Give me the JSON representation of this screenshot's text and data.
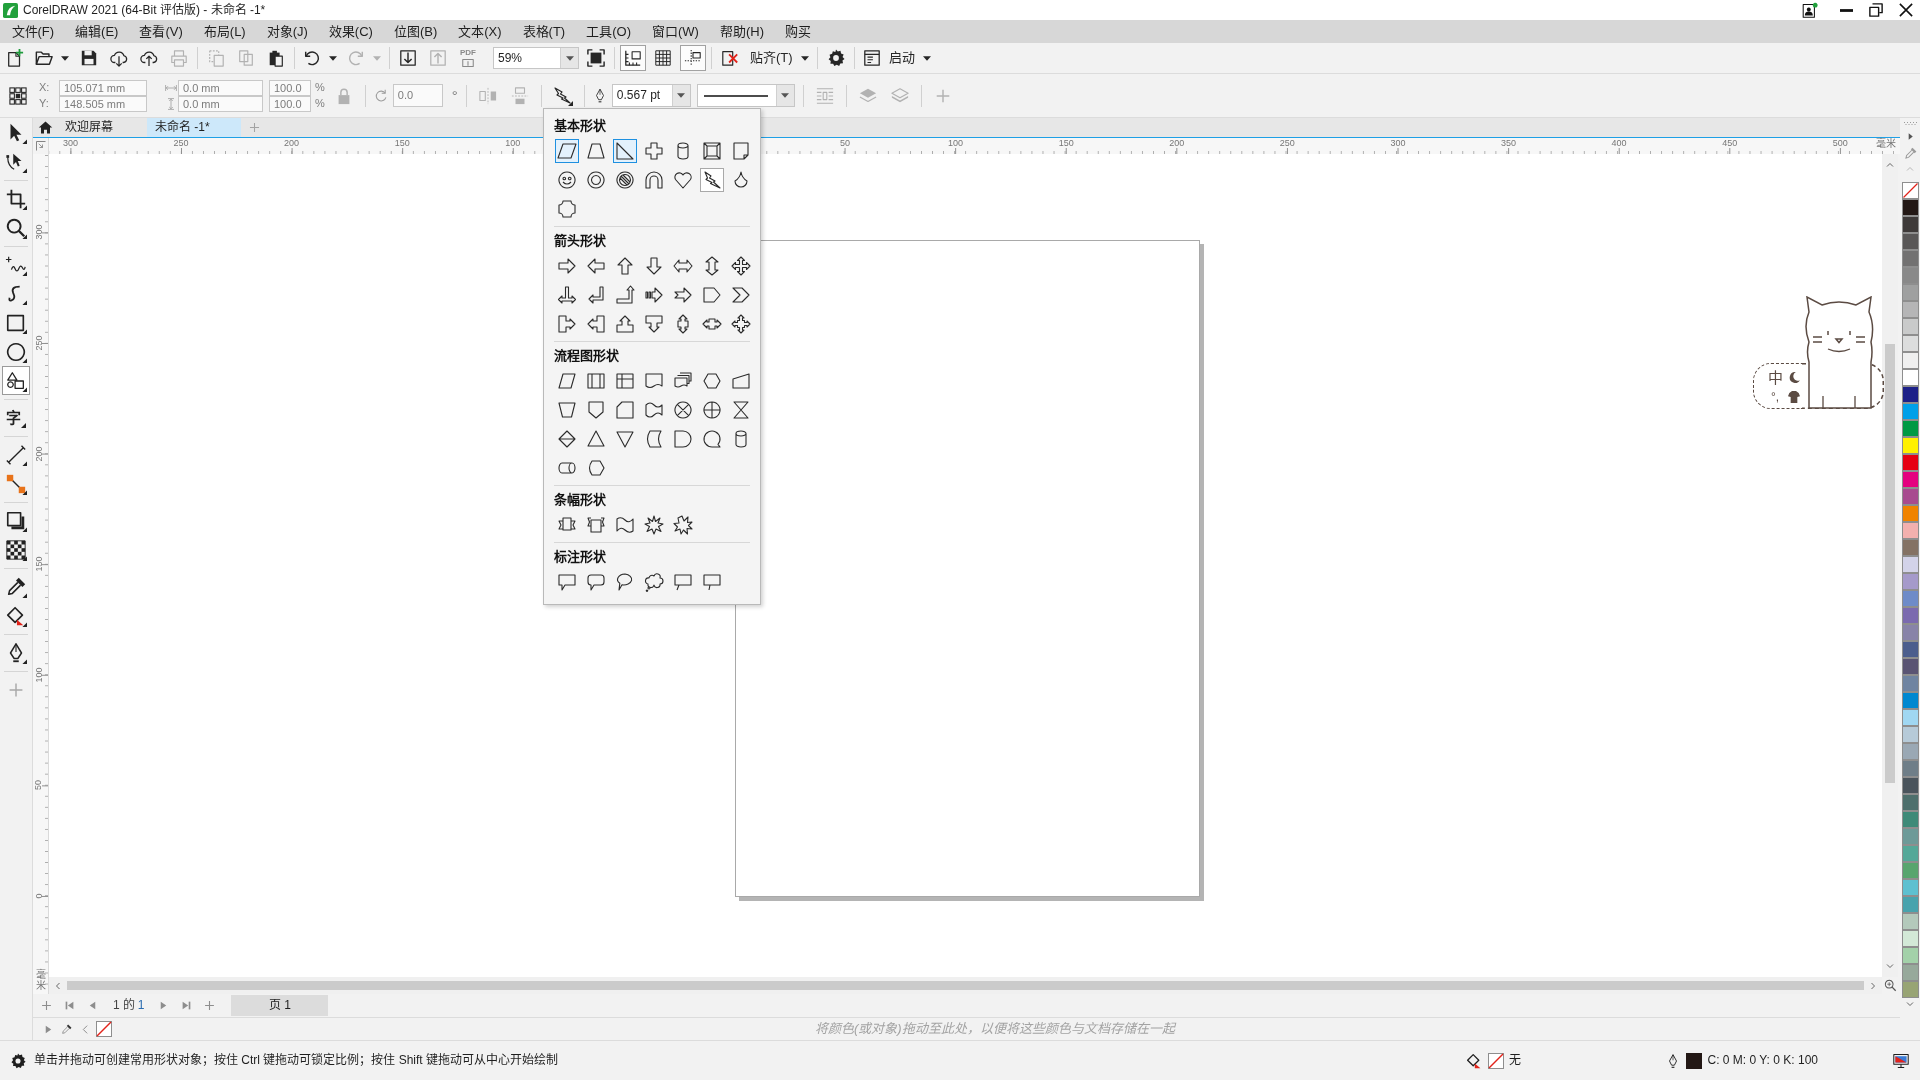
{
  "window": {
    "title": "CorelDRAW 2021 (64-Bit 评估版) - 未命名 -1*"
  },
  "menu_bar": [
    "文件(F)",
    "编辑(E)",
    "查看(V)",
    "布局(L)",
    "对象(J)",
    "效果(C)",
    "位图(B)",
    "文本(X)",
    "表格(T)",
    "工具(O)",
    "窗口(W)",
    "帮助(H)",
    "购买"
  ],
  "standard_toolbar": [
    [
      {
        "kind": "new",
        "disabled": false,
        "active": false,
        "dropdown": false
      },
      {
        "kind": "open",
        "disabled": false,
        "active": false,
        "dropdown": true
      },
      {
        "kind": "save",
        "disabled": false,
        "active": false,
        "dropdown": false
      },
      {
        "kind": "clouddown",
        "disabled": false,
        "active": false,
        "dropdown": false
      },
      {
        "kind": "cloudup",
        "disabled": false,
        "active": false,
        "dropdown": false
      },
      {
        "kind": "print",
        "disabled": true,
        "active": false,
        "dropdown": false
      }
    ],
    [
      {
        "kind": "cut",
        "disabled": true,
        "active": false,
        "dropdown": false
      },
      {
        "kind": "copy",
        "disabled": true,
        "active": false,
        "dropdown": false
      },
      {
        "kind": "paste",
        "disabled": false,
        "active": false,
        "dropdown": false
      }
    ],
    [
      {
        "kind": "undo",
        "disabled": false,
        "active": false,
        "dropdown": true
      },
      {
        "kind": "redo",
        "disabled": true,
        "active": false,
        "dropdown": true
      }
    ],
    [
      {
        "kind": "import",
        "disabled": false,
        "active": false,
        "dropdown": false
      },
      {
        "kind": "export",
        "disabled": true,
        "active": false,
        "dropdown": false
      },
      {
        "kind": "pdf",
        "label": "PDF",
        "disabled": true,
        "active": false,
        "dropdown": false
      },
      {
        "kind": "zoom",
        "value": "59%",
        "disabled": false,
        "active": false,
        "dropdown": true
      },
      {
        "kind": "fullscreen",
        "disabled": false,
        "active": false,
        "dropdown": false
      }
    ],
    [
      {
        "kind": "rulers",
        "disabled": false,
        "active": true,
        "dropdown": false
      },
      {
        "kind": "grid",
        "disabled": false,
        "active": false,
        "dropdown": false
      },
      {
        "kind": "guidelines",
        "disabled": false,
        "active": true,
        "dropdown": false
      }
    ],
    [
      {
        "kind": "snapoff",
        "disabled": false,
        "active": false,
        "dropdown": false
      },
      {
        "kind": "snap",
        "label": "贴齐(T)",
        "disabled": false,
        "active": false,
        "dropdown": true
      }
    ],
    [
      {
        "kind": "options",
        "disabled": false,
        "active": false,
        "dropdown": false
      }
    ],
    [
      {
        "kind": "launch",
        "label": "启动",
        "disabled": false,
        "active": false,
        "dropdown": true
      }
    ]
  ],
  "property_bar": [
    [
      {
        "kind": "origin",
        "disabled": false
      },
      {
        "kind": "position",
        "disabled": true,
        "rows": [
          {
            "label": "X:",
            "value": "105.071 mm"
          },
          {
            "label": "Y:",
            "value": "148.505 mm"
          }
        ]
      },
      {
        "kind": "size",
        "disabled": true,
        "rows": [
          {
            "value": "0.0 mm"
          },
          {
            "value": "0.0 mm"
          }
        ]
      },
      {
        "kind": "scale",
        "disabled": true,
        "rows": [
          {
            "value": "100.0",
            "unit": "%"
          },
          {
            "value": "100.0",
            "unit": "%"
          }
        ]
      },
      {
        "kind": "lock",
        "disabled": true
      }
    ],
    [
      {
        "kind": "rotation",
        "disabled": true,
        "value": "0.0",
        "unit": "°"
      }
    ],
    [
      {
        "kind": "mirrorh",
        "disabled": true
      },
      {
        "kind": "mirrorv",
        "disabled": true
      }
    ],
    [
      {
        "kind": "shapes",
        "disabled": false
      }
    ],
    [
      {
        "kind": "outline",
        "disabled": false,
        "value": "0.567 pt"
      },
      {
        "kind": "linestyle",
        "disabled": false
      }
    ],
    [
      {
        "kind": "wrap",
        "disabled": true
      }
    ],
    [
      {
        "kind": "front",
        "disabled": true
      },
      {
        "kind": "back",
        "disabled": true
      }
    ],
    [
      {
        "kind": "add",
        "disabled": true
      }
    ]
  ],
  "document_tabs": [
    {
      "label": "欢迎屏幕",
      "selected": false
    },
    {
      "label": "未命名 -1*",
      "selected": true
    }
  ],
  "toolbox": [
    [
      {
        "kind": "pick",
        "selected": false
      },
      {
        "kind": "shape",
        "selected": false
      }
    ],
    [
      {
        "kind": "crop",
        "selected": false
      },
      {
        "kind": "zoom",
        "selected": false
      }
    ],
    [
      {
        "kind": "freehand",
        "selected": false
      },
      {
        "kind": "artistic",
        "selected": false
      },
      {
        "kind": "rectangle",
        "selected": false
      },
      {
        "kind": "ellipse",
        "selected": false
      },
      {
        "kind": "shapes",
        "selected": true
      }
    ],
    [
      {
        "kind": "text",
        "label": "字",
        "selected": false
      }
    ],
    [
      {
        "kind": "dimension",
        "selected": false
      },
      {
        "kind": "connector",
        "selected": false
      }
    ],
    [
      {
        "kind": "shadow",
        "selected": false
      },
      {
        "kind": "transparency",
        "selected": false
      }
    ],
    [
      {
        "kind": "eyedropper",
        "selected": false
      },
      {
        "kind": "fill",
        "selected": false
      }
    ],
    [
      {
        "kind": "outline",
        "selected": false
      }
    ],
    [
      {
        "kind": "add",
        "selected": false
      }
    ]
  ],
  "horizontal_ruler": {
    "segments": [
      [
        "300",
        "250",
        "200",
        "150",
        "100"
      ],
      [
        "50",
        "100",
        "150",
        "200",
        "250",
        "300",
        "350",
        "400",
        "450",
        "500"
      ]
    ],
    "unit": "毫米"
  },
  "vertical_ruler": {
    "labels": [
      "300",
      "250",
      "200",
      "150",
      "100",
      "50",
      "0"
    ],
    "unit": "毫米"
  },
  "shape_flyout": [
    {
      "title": "基本形状",
      "shapes": [
        {
          "kind": "parallelogram",
          "highlighted": true,
          "selected": false
        },
        {
          "kind": "trapezoid",
          "highlighted": false,
          "selected": false
        },
        {
          "kind": "triangle",
          "highlighted": true,
          "selected": false
        },
        {
          "kind": "cross",
          "highlighted": false,
          "selected": false
        },
        {
          "kind": "cylinder",
          "highlighted": false,
          "selected": false
        },
        {
          "kind": "bevel",
          "highlighted": false,
          "selected": false
        },
        {
          "kind": "foldedpage",
          "highlighted": false,
          "selected": false
        },
        {
          "kind": "smiley",
          "highlighted": false,
          "selected": false
        },
        {
          "kind": "donut",
          "highlighted": false,
          "selected": false
        },
        {
          "kind": "nosign",
          "highlighted": false,
          "selected": false
        },
        {
          "kind": "arch",
          "highlighted": false,
          "selected": false
        },
        {
          "kind": "heart",
          "highlighted": false,
          "selected": false
        },
        {
          "kind": "lightning",
          "highlighted": false,
          "selected": true
        },
        {
          "kind": "teardrop",
          "highlighted": false,
          "selected": false
        },
        {
          "kind": "plaque",
          "highlighted": false,
          "selected": false
        }
      ]
    },
    {
      "title": "箭头形状",
      "shapes": [
        {
          "kind": "right",
          "highlighted": false,
          "selected": false
        },
        {
          "kind": "left",
          "highlighted": false,
          "selected": false
        },
        {
          "kind": "up",
          "highlighted": false,
          "selected": false
        },
        {
          "kind": "down",
          "highlighted": false,
          "selected": false
        },
        {
          "kind": "leftright",
          "highlighted": false,
          "selected": false
        },
        {
          "kind": "updown",
          "highlighted": false,
          "selected": false
        },
        {
          "kind": "quad",
          "highlighted": false,
          "selected": false
        },
        {
          "kind": "leftrightup",
          "highlighted": false,
          "selected": false
        },
        {
          "kind": "leftup",
          "highlighted": false,
          "selected": false
        },
        {
          "kind": "corner",
          "highlighted": false,
          "selected": false
        },
        {
          "kind": "striped",
          "highlighted": false,
          "selected": false
        },
        {
          "kind": "notched",
          "highlighted": false,
          "selected": false
        },
        {
          "kind": "pentagon",
          "highlighted": false,
          "selected": false
        },
        {
          "kind": "chevron",
          "highlighted": false,
          "selected": false
        },
        {
          "kind": "rightcallout",
          "highlighted": false,
          "selected": false
        },
        {
          "kind": "leftcallout",
          "highlighted": false,
          "selected": false
        },
        {
          "kind": "upcallout",
          "highlighted": false,
          "selected": false
        },
        {
          "kind": "downcallout",
          "highlighted": false,
          "selected": false
        },
        {
          "kind": "updowncallout",
          "highlighted": false,
          "selected": false
        },
        {
          "kind": "leftrightcallout",
          "highlighted": false,
          "selected": false
        },
        {
          "kind": "quadcallout",
          "highlighted": false,
          "selected": false
        }
      ]
    },
    {
      "title": "流程图形状",
      "shapes": [
        {
          "kind": "data",
          "highlighted": false,
          "selected": false
        },
        {
          "kind": "predefined",
          "highlighted": false,
          "selected": false
        },
        {
          "kind": "storage",
          "highlighted": false,
          "selected": false
        },
        {
          "kind": "document",
          "highlighted": false,
          "selected": false
        },
        {
          "kind": "multidocument",
          "highlighted": false,
          "selected": false
        },
        {
          "kind": "preparation",
          "highlighted": false,
          "selected": false
        },
        {
          "kind": "manualinput",
          "highlighted": false,
          "selected": false
        },
        {
          "kind": "manualop",
          "highlighted": false,
          "selected": false
        },
        {
          "kind": "offpage",
          "highlighted": false,
          "selected": false
        },
        {
          "kind": "card",
          "highlighted": false,
          "selected": false
        },
        {
          "kind": "tape",
          "highlighted": false,
          "selected": false
        },
        {
          "kind": "summing",
          "highlighted": false,
          "selected": false
        },
        {
          "kind": "or",
          "highlighted": false,
          "selected": false
        },
        {
          "kind": "collate",
          "highlighted": false,
          "selected": false
        },
        {
          "kind": "sort",
          "highlighted": false,
          "selected": false
        },
        {
          "kind": "extract",
          "highlighted": false,
          "selected": false
        },
        {
          "kind": "merge",
          "highlighted": false,
          "selected": false
        },
        {
          "kind": "storeddata",
          "highlighted": false,
          "selected": false
        },
        {
          "kind": "delay",
          "highlighted": false,
          "selected": false
        },
        {
          "kind": "sequential",
          "highlighted": false,
          "selected": false
        },
        {
          "kind": "cylinder",
          "highlighted": false,
          "selected": false
        },
        {
          "kind": "drum",
          "highlighted": false,
          "selected": false
        },
        {
          "kind": "display",
          "highlighted": false,
          "selected": false
        }
      ]
    },
    {
      "title": "条幅形状",
      "shapes": [
        {
          "kind": "ribbon",
          "highlighted": false,
          "selected": false
        },
        {
          "kind": "ribbondown",
          "highlighted": false,
          "selected": false
        },
        {
          "kind": "wave",
          "highlighted": false,
          "selected": false
        },
        {
          "kind": "explosion",
          "highlighted": false,
          "selected": false
        },
        {
          "kind": "explosion2",
          "highlighted": false,
          "selected": false
        }
      ]
    },
    {
      "title": "标注形状",
      "shapes": [
        {
          "kind": "rectcallout",
          "highlighted": false,
          "selected": false
        },
        {
          "kind": "roundcallout",
          "highlighted": false,
          "selected": false
        },
        {
          "kind": "ovalcallout",
          "highlighted": false,
          "selected": false
        },
        {
          "kind": "cloudcallout",
          "highlighted": false,
          "selected": false
        },
        {
          "kind": "linecallout",
          "highlighted": false,
          "selected": false
        },
        {
          "kind": "linecallout2",
          "highlighted": false,
          "selected": false
        }
      ]
    }
  ],
  "ime_status": {
    "mode": "中",
    "punctuation": "°,"
  },
  "color_palette": [
    {
      "kind": "none"
    },
    {
      "kind": "color",
      "color": "#231815"
    },
    {
      "kind": "color",
      "color": "#3e3a39"
    },
    {
      "kind": "color",
      "color": "#595757"
    },
    {
      "kind": "color",
      "color": "#727171"
    },
    {
      "kind": "color",
      "color": "#898989"
    },
    {
      "kind": "color",
      "color": "#9fa0a0"
    },
    {
      "kind": "color",
      "color": "#b5b5b6"
    },
    {
      "kind": "color",
      "color": "#c9caca"
    },
    {
      "kind": "color",
      "color": "#dcdddd"
    },
    {
      "kind": "color",
      "color": "#efefef"
    },
    {
      "kind": "color",
      "color": "#ffffff"
    },
    {
      "kind": "color",
      "color": "#1d2088"
    },
    {
      "kind": "color",
      "color": "#00a0e9"
    },
    {
      "kind": "color",
      "color": "#009944"
    },
    {
      "kind": "color",
      "color": "#fff100"
    },
    {
      "kind": "color",
      "color": "#e60012"
    },
    {
      "kind": "color",
      "color": "#e4007f"
    },
    {
      "kind": "color",
      "color": "#a84b8f"
    },
    {
      "kind": "color",
      "color": "#f08300"
    },
    {
      "kind": "color",
      "color": "#f3b0ae"
    },
    {
      "kind": "color",
      "color": "#847264"
    },
    {
      "kind": "color",
      "color": "#d3d3e9"
    },
    {
      "kind": "color",
      "color": "#a59aca"
    },
    {
      "kind": "color",
      "color": "#6e8bc8"
    },
    {
      "kind": "color",
      "color": "#7b6aaf"
    },
    {
      "kind": "color",
      "color": "#8883a8"
    },
    {
      "kind": "color",
      "color": "#4c5e8d"
    },
    {
      "kind": "color",
      "color": "#5a5473"
    },
    {
      "kind": "color",
      "color": "#6f84a1"
    },
    {
      "kind": "color",
      "color": "#0088d0"
    },
    {
      "kind": "color",
      "color": "#a0d7f2"
    },
    {
      "kind": "color",
      "color": "#b6cad8"
    },
    {
      "kind": "color",
      "color": "#9aa8b4"
    },
    {
      "kind": "color",
      "color": "#6f7e88"
    },
    {
      "kind": "color",
      "color": "#4a545c"
    },
    {
      "kind": "color",
      "color": "#4d6f6c"
    },
    {
      "kind": "color",
      "color": "#3f8a78"
    },
    {
      "kind": "color",
      "color": "#6d9a98"
    },
    {
      "kind": "color",
      "color": "#54a898"
    },
    {
      "kind": "color",
      "color": "#58a56e"
    },
    {
      "kind": "color",
      "color": "#5dc0d0"
    },
    {
      "kind": "color",
      "color": "#48a3ad"
    },
    {
      "kind": "color",
      "color": "#b3c9bb"
    },
    {
      "kind": "color",
      "color": "#d3e9d7"
    },
    {
      "kind": "color",
      "color": "#a3d1a9"
    },
    {
      "kind": "color",
      "color": "#97a99b"
    },
    {
      "kind": "color",
      "color": "#98a474"
    }
  ],
  "page_navigator": {
    "current": "1",
    "of": "的",
    "total": "1",
    "pages": [
      {
        "label": "页 1",
        "selected": true
      }
    ]
  },
  "document_palette": {
    "hint": "将颜色(或对象)拖动至此处，以便将这些颜色与文档存储在一起"
  },
  "status_bar": {
    "hint": "单击并拖动可创建常用形状对象；按住 Ctrl 键拖动可锁定比例；按住 Shift 键拖动可从中心开始绘制",
    "fill": {
      "kind": "none",
      "label": "无"
    },
    "outline": {
      "color": "#231815",
      "values": "C: 0 M: 0 Y: 0 K: 100"
    }
  }
}
